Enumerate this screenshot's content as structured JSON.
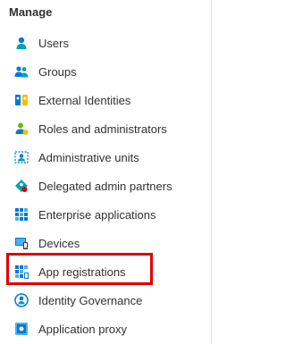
{
  "section": {
    "title": "Manage"
  },
  "nav": {
    "items": [
      {
        "label": "Users",
        "icon": "user-icon"
      },
      {
        "label": "Groups",
        "icon": "groups-icon"
      },
      {
        "label": "External Identities",
        "icon": "external-identities-icon"
      },
      {
        "label": "Roles and administrators",
        "icon": "roles-icon"
      },
      {
        "label": "Administrative units",
        "icon": "admin-units-icon"
      },
      {
        "label": "Delegated admin partners",
        "icon": "delegated-admin-icon"
      },
      {
        "label": "Enterprise applications",
        "icon": "enterprise-apps-icon"
      },
      {
        "label": "Devices",
        "icon": "devices-icon"
      },
      {
        "label": "App registrations",
        "icon": "app-registrations-icon",
        "highlighted": true
      },
      {
        "label": "Identity Governance",
        "icon": "identity-governance-icon"
      },
      {
        "label": "Application proxy",
        "icon": "application-proxy-icon"
      }
    ]
  },
  "colors": {
    "text": "#323130",
    "highlight_border": "#e00000",
    "icon_blue": "#0078d4",
    "icon_teal": "#00a3b5",
    "icon_green": "#6bb700"
  }
}
